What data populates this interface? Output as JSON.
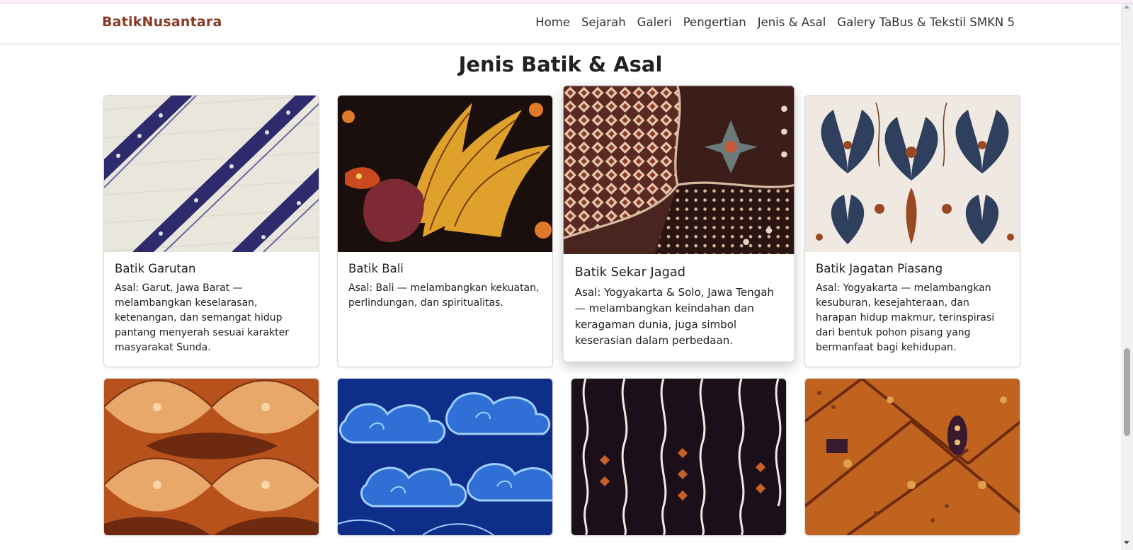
{
  "brand": "BatikNusantara",
  "nav": [
    "Home",
    "Sejarah",
    "Galeri",
    "Pengertian",
    "Jenis & Asal",
    "Galery TaBus & Tekstil SMKN 5"
  ],
  "section_title": "Jenis Batik & Asal",
  "cards": [
    {
      "title": "Batik Garutan",
      "text": "Asal: Garut, Jawa Barat — melambangkan keselarasan, ketenangan, dan semangat hidup pantang menyerah sesuai karakter masyarakat Sunda.",
      "image": "parang-diagonal-pattern"
    },
    {
      "title": "Batik Bali",
      "text": "Asal: Bali — melambangkan kekuatan, perlindungan, dan spiritualitas.",
      "image": "garuda-bird-pattern"
    },
    {
      "title": "Batik Sekar Jagad",
      "text": "Asal: Yogyakarta & Solo, Jawa Tengah — melambangkan keindahan dan keragaman dunia, juga simbol keserasian dalam perbedaan.",
      "image": "sekar-jagad-pattern"
    },
    {
      "title": "Batik Jagatan Piasang",
      "text": "Asal: Yogyakarta — melambangkan kesuburan, kesejahteraan, dan harapan hidup makmur, terinspirasi dari bentuk pohon pisang yang bermanfaat bagi kehidupan.",
      "image": "floral-pattern"
    },
    {
      "title": "",
      "text": "",
      "image": "orange-wave-pattern"
    },
    {
      "title": "",
      "text": "",
      "image": "mega-mendung-cloud-pattern"
    },
    {
      "title": "",
      "text": "",
      "image": "lereng-stripe-pattern"
    },
    {
      "title": "",
      "text": "",
      "image": "kawung-diamond-pattern"
    }
  ],
  "colors": {
    "brand": "#8a3b26",
    "text": "#222222",
    "card_border": "#d8d8d8"
  }
}
